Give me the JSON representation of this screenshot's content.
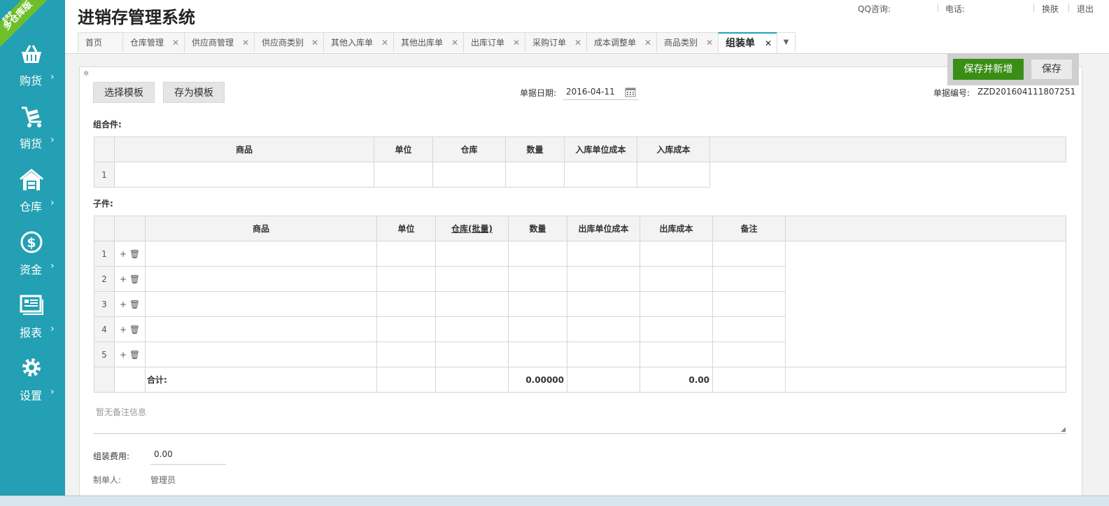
{
  "sidebar": {
    "badge": "多仓库版",
    "badge_small": "ERP",
    "items": [
      {
        "label": "购货",
        "icon": "basket-icon"
      },
      {
        "label": "销货",
        "icon": "cart-icon"
      },
      {
        "label": "仓库",
        "icon": "warehouse-icon"
      },
      {
        "label": "资金",
        "icon": "dollar-icon"
      },
      {
        "label": "报表",
        "icon": "report-icon"
      },
      {
        "label": "设置",
        "icon": "gear-icon"
      }
    ],
    "arrow": "›"
  },
  "header": {
    "title": "进销存管理系统",
    "qq_label": "QQ咨询:",
    "phone_label": "电话:",
    "skin": "换肤",
    "logout": "退出"
  },
  "tabs": [
    {
      "label": "首页",
      "closable": false
    },
    {
      "label": "仓库管理",
      "closable": true
    },
    {
      "label": "供应商管理",
      "closable": true
    },
    {
      "label": "供应商类别",
      "closable": true
    },
    {
      "label": "其他入库单",
      "closable": true
    },
    {
      "label": "其他出库单",
      "closable": true
    },
    {
      "label": "出库订单",
      "closable": true
    },
    {
      "label": "采购订单",
      "closable": true
    },
    {
      "label": "成本调整单",
      "closable": true
    },
    {
      "label": "商品类别",
      "closable": true
    },
    {
      "label": "组装单",
      "closable": true,
      "active": true
    }
  ],
  "toolbar": {
    "select_template": "选择模板",
    "save_template": "存为模板",
    "date_label": "单据日期:",
    "date_value": "2016-04-11",
    "doc_no_label": "单据编号:",
    "doc_no_value": "ZZD201604111807251",
    "save_new": "保存并新增",
    "save": "保存"
  },
  "assembly": {
    "label": "组合件:",
    "columns": [
      "商品",
      "单位",
      "仓库",
      "数量",
      "入库单位成本",
      "入库成本"
    ],
    "rows": [
      "1"
    ]
  },
  "components": {
    "label": "子件:",
    "columns": [
      "商品",
      "单位",
      "仓库(批量)",
      "数量",
      "出库单位成本",
      "出库成本",
      "备注"
    ],
    "rows": [
      "1",
      "2",
      "3",
      "4",
      "5"
    ],
    "total_label": "合计:",
    "total_qty": "0.00000",
    "total_cost": "0.00"
  },
  "remark_placeholder": "暂无备注信息",
  "footer": {
    "fee_label": "组装费用:",
    "fee_value": "0.00",
    "creator_label": "制单人:",
    "creator_value": "管理员"
  },
  "colors": {
    "sidebar": "#23a0b3",
    "primary_button": "#3a8e16",
    "badge": "#6fbf2a"
  }
}
